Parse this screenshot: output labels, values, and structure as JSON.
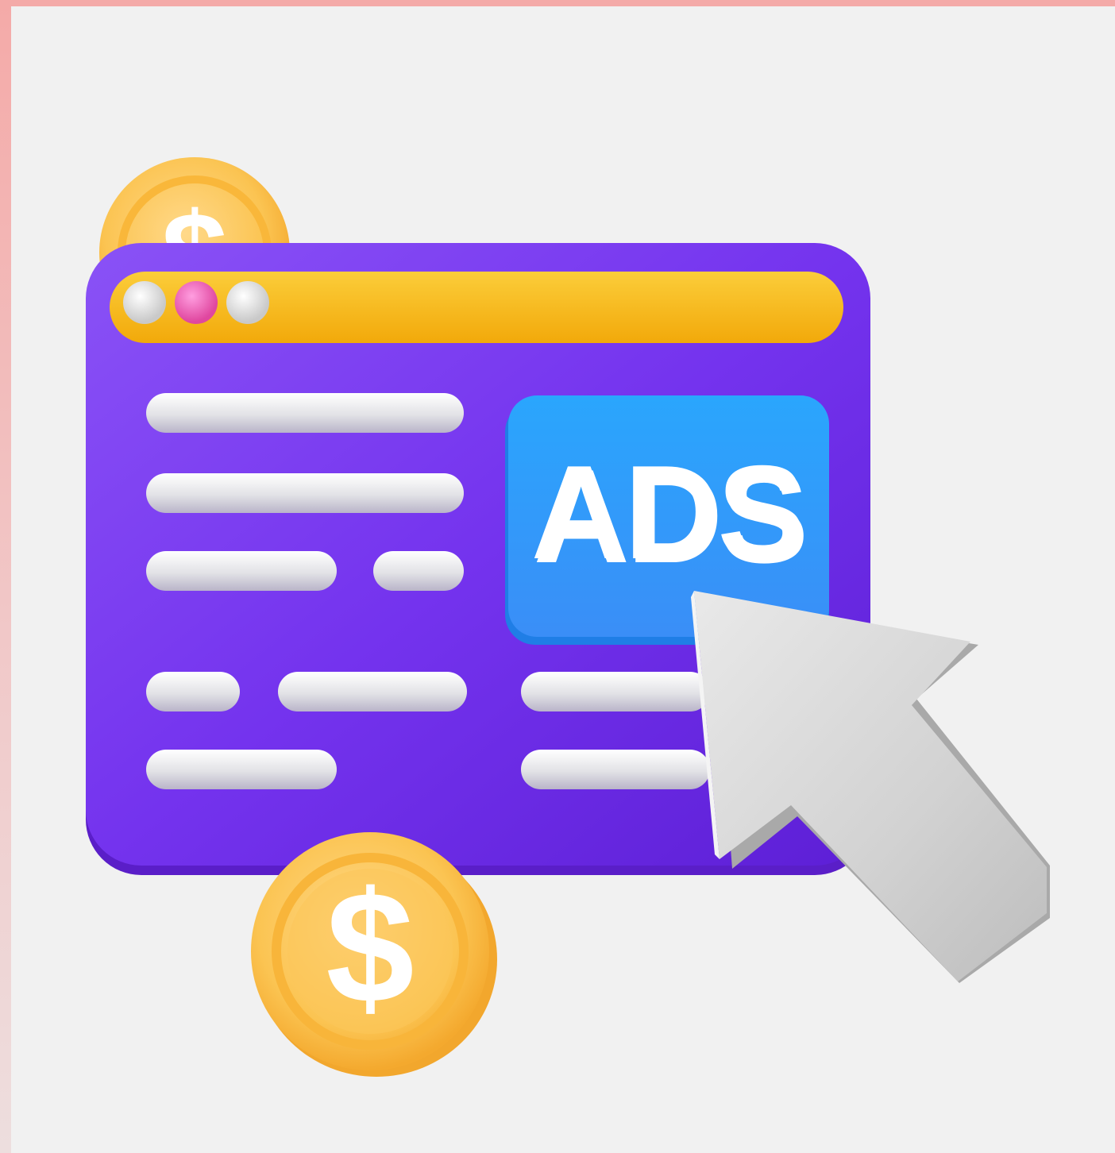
{
  "illustration": {
    "ad_label": "ADS",
    "currency_symbol": "$",
    "icons": [
      "coin-icon",
      "browser-window-icon",
      "cursor-arrow-icon"
    ],
    "colors": {
      "window": "#7436f0",
      "title_bar": "#f6b810",
      "ad_box": "#2f9bfb",
      "coin": "#fbc64e",
      "cursor": "#d6d6d6",
      "dot_active": "#f46bc6",
      "dot_inactive": "#e4e4e4",
      "text_line": "#ececec",
      "page_background": "#f1f1f1",
      "outer_frame": "#f4aaa8"
    }
  }
}
